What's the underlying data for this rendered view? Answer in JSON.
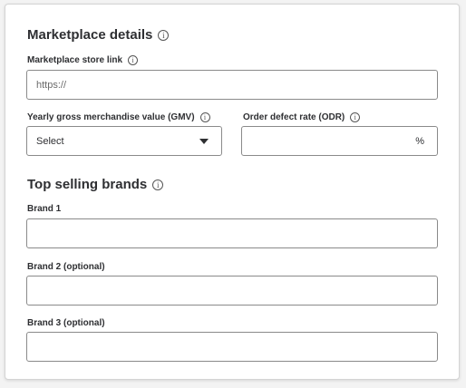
{
  "marketplace": {
    "title": "Marketplace details",
    "store_link_label": "Marketplace store link",
    "store_link_placeholder": "https://",
    "gmv_label": "Yearly gross merchandise value (GMV)",
    "gmv_selected": "Select",
    "odr_label": "Order defect rate (ODR)",
    "odr_suffix": "%"
  },
  "brands": {
    "title": "Top selling brands",
    "brand1_label": "Brand 1",
    "brand2_label": "Brand 2 (optional)",
    "brand3_label": "Brand 3 (optional)"
  },
  "icons": {
    "info": "info-icon",
    "dropdown": "chevron-down-icon"
  },
  "colors": {
    "border": "#8a8a8a",
    "text": "#2e2f32"
  }
}
